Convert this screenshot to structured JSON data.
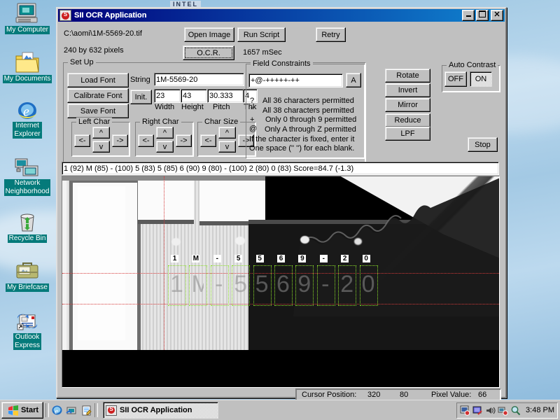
{
  "desktop": {
    "watermark": "INTEL",
    "icons": [
      {
        "name": "my-computer",
        "label": [
          "My Computer"
        ]
      },
      {
        "name": "my-documents",
        "label": [
          "My Documents"
        ]
      },
      {
        "name": "internet-explorer",
        "label": [
          "Internet",
          "Explorer"
        ]
      },
      {
        "name": "network-neighborhood",
        "label": [
          "Network",
          "Neighborhood"
        ]
      },
      {
        "name": "recycle-bin",
        "label": [
          "Recycle Bin"
        ]
      },
      {
        "name": "my-briefcase",
        "label": [
          "My Briefcase"
        ]
      },
      {
        "name": "outlook-express",
        "label": [
          "Outlook",
          "Express"
        ]
      }
    ]
  },
  "window": {
    "title": "SII OCR Application",
    "minimize": "_",
    "maximize": "□",
    "close": "✕",
    "file_path": "C:\\aomi\\1M-5569-20.tif",
    "image_size": "240 by 632 pixels",
    "elapsed": "1657 mSec",
    "open_image": "Open Image",
    "run_script": "Run Script",
    "retry": "Retry",
    "ocr": "O.C.R.",
    "stop": "Stop"
  },
  "setup": {
    "caption": "Set Up",
    "load_font": "Load Font",
    "calibrate_font": "Calibrate Font",
    "save_font": "Save Font",
    "string_label": "String",
    "string_value": "1M-5569-20",
    "init": "Init.",
    "width_value": "23",
    "height_value": "43",
    "pitch_value": "30.333",
    "thk_value": "4",
    "width_label": "Width",
    "height_label": "Height",
    "pitch_label": "Pitch",
    "thk_label": "Thk",
    "left_char": "Left Char",
    "right_char": "Right Char",
    "char_size": "Char Size",
    "arrow_left": "<-",
    "arrow_right": "->",
    "arrow_up": "^",
    "arrow_down": "v"
  },
  "constraints": {
    "caption": "Field Constraints",
    "value": "+@-+++++-++",
    "a_button": "A",
    "legend": [
      {
        "sym": "?",
        "text": "All 36 characters permitted"
      },
      {
        "sym": "*",
        "text": "All 38 characters permitted"
      },
      {
        "sym": "+",
        "text": "Only 0 through 9 permitted"
      },
      {
        "sym": "@",
        "text": "Only A through Z permitted"
      }
    ],
    "note1": "If the character is fixed, enter it",
    "note2": "One space ('' '') for each blank."
  },
  "tools": {
    "rotate": "Rotate",
    "invert": "Invert",
    "mirror": "Mirror",
    "reduce": "Reduce",
    "lpf": "LPF"
  },
  "auto_contrast": {
    "caption": "Auto Contrast",
    "off": "OFF",
    "on": "ON",
    "selected": "ON"
  },
  "result": {
    "line": "1 (92) M (85) - (100) 5 (83) 5 (85) 6 (90) 9 (80) - (100) 2 (80) 0 (83)   Score=84.7    (-1.3)"
  },
  "ocr_overlay": {
    "chars": [
      "1",
      "M",
      "-",
      "5",
      "5",
      "6",
      "9",
      "-",
      "2",
      "0"
    ]
  },
  "statusbar": {
    "cursor_label": "Cursor Position:",
    "cursor_x": "320",
    "cursor_y": "80",
    "pixel_label": "Pixel Value:",
    "pixel_value": "66"
  },
  "taskbar": {
    "start": "Start",
    "task": "SII OCR Application",
    "clock": "3:48 PM"
  }
}
